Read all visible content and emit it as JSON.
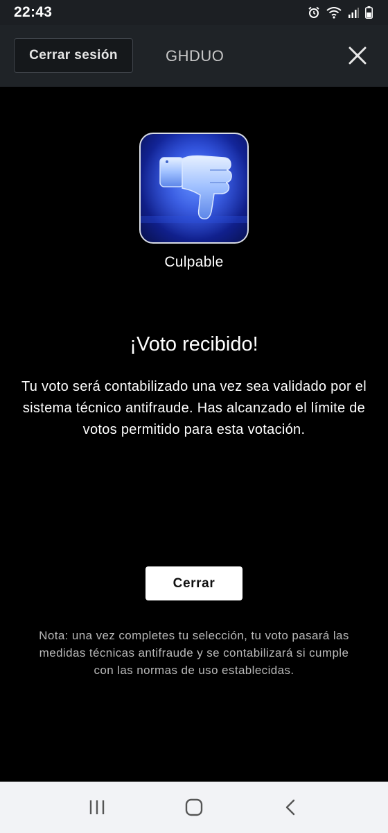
{
  "status_bar": {
    "time": "22:43",
    "icons": [
      "alarm-icon",
      "wifi-icon",
      "signal-icon",
      "battery-icon"
    ]
  },
  "header": {
    "logout_label": "Cerrar sesión",
    "show_name": "GHDUO",
    "close_icon": "close-icon"
  },
  "vote": {
    "icon": "thumbs-down-icon",
    "option_label": "Culpable"
  },
  "confirmation": {
    "headline": "¡Voto recibido!",
    "message": "Tu voto será contabilizado una vez sea validado por el sistema técnico antifraude. Has alcanzado el límite de votos permitido para esta votación.",
    "close_label": "Cerrar",
    "note": "Nota: una vez completes tu selección, tu voto pasará las medidas técnicas antifraude y se contabilizará si cumple con las normas de uso establecidas."
  },
  "nav_bar": {
    "buttons": [
      "recent-apps-icon",
      "home-icon",
      "back-icon"
    ]
  },
  "colors": {
    "background": "#000000",
    "header": "#1f2327",
    "tile_blue": "#1f3dd0",
    "note_text": "#b9b9b9"
  }
}
